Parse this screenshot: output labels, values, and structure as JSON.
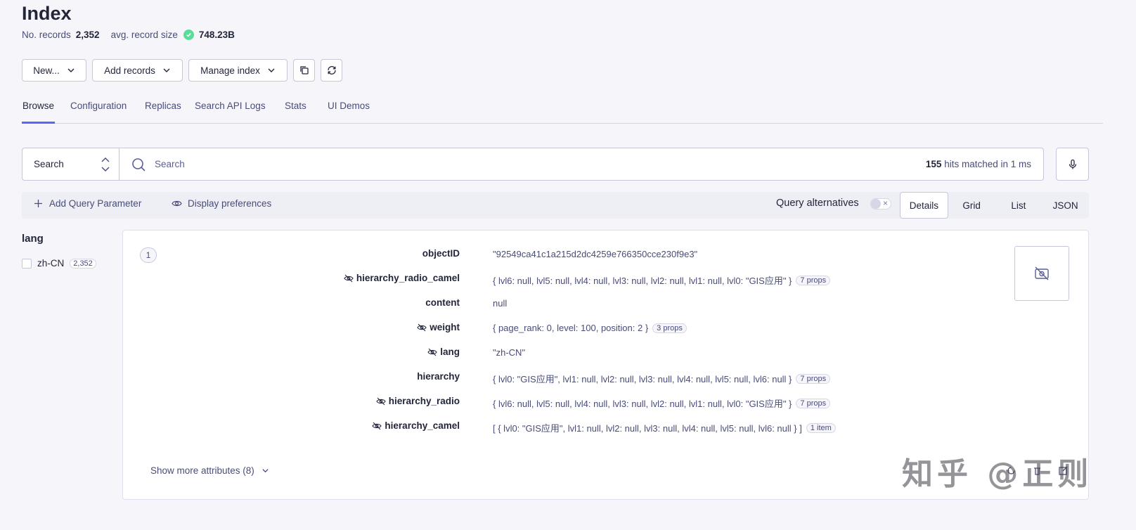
{
  "header": {
    "title": "Index",
    "records_label": "No. records",
    "records_value": "2,352",
    "size_label": "avg. record size",
    "size_value": "748.23B"
  },
  "actions": {
    "new_label": "New...",
    "add_records_label": "Add records",
    "manage_index_label": "Manage index"
  },
  "tabs": [
    "Browse",
    "Configuration",
    "Replicas",
    "Search API Logs",
    "Stats",
    "UI Demos"
  ],
  "search": {
    "type_label": "Search",
    "placeholder": "Search",
    "hits_count": "155",
    "hits_text": "hits matched in 1 ms"
  },
  "toolbar": {
    "add_query_param": "Add Query Parameter",
    "display_prefs": "Display preferences",
    "query_alternatives": "Query alternatives",
    "views": [
      "Details",
      "Grid",
      "List",
      "JSON"
    ],
    "active_view": "Details"
  },
  "facet": {
    "title": "lang",
    "items": [
      {
        "label": "zh-CN",
        "count": "2,352"
      }
    ]
  },
  "record": {
    "number": "1",
    "attributes": [
      {
        "key": "objectID",
        "hidden": false,
        "value": "\"92549ca41c1a215d2dc4259e766350cce230f9e3\"",
        "badge": ""
      },
      {
        "key": "hierarchy_radio_camel",
        "hidden": true,
        "value": "{ lvl6: null, lvl5: null, lvl4: null, lvl3: null, lvl2: null, lvl1: null, lvl0: \"GIS应用\" }",
        "badge": "7 props"
      },
      {
        "key": "content",
        "hidden": false,
        "value": "null",
        "badge": ""
      },
      {
        "key": "weight",
        "hidden": true,
        "value": "{ page_rank: 0, level: 100, position: 2 }",
        "badge": "3 props"
      },
      {
        "key": "lang",
        "hidden": true,
        "value": "\"zh-CN\"",
        "badge": ""
      },
      {
        "key": "hierarchy",
        "hidden": false,
        "value": "{ lvl0: \"GIS应用\", lvl1: null, lvl2: null, lvl3: null, lvl4: null, lvl5: null, lvl6: null }",
        "badge": "7 props"
      },
      {
        "key": "hierarchy_radio",
        "hidden": true,
        "value": "{ lvl6: null, lvl5: null, lvl4: null, lvl3: null, lvl2: null, lvl1: null, lvl0: \"GIS应用\" }",
        "badge": "7 props"
      },
      {
        "key": "hierarchy_camel",
        "hidden": true,
        "value": "[ { lvl0: \"GIS应用\", lvl1: null, lvl2: null, lvl3: null, lvl4: null, lvl5: null, lvl6: null } ]",
        "badge": "1 item"
      }
    ],
    "show_more": "Show more attributes (8)"
  },
  "watermark": "知乎 @正则",
  "colors": {
    "accent": "#5468ff",
    "success": "#5adc9a"
  }
}
